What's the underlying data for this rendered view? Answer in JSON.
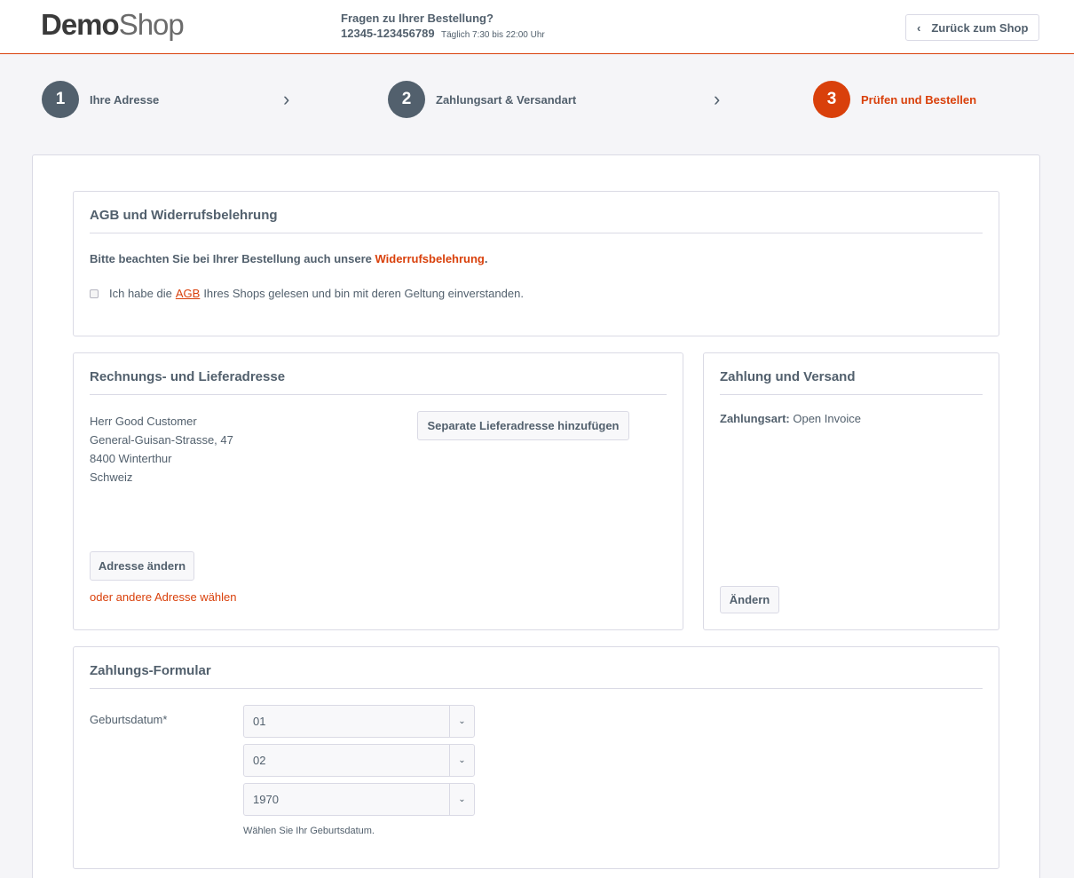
{
  "header": {
    "logo_demo": "Demo",
    "logo_shop": "Shop",
    "question": "Fragen zu Ihrer Bestellung?",
    "phone": "12345-123456789",
    "hours": "Täglich 7:30 bis 22:00 Uhr",
    "back_label": "Zurück zum Shop"
  },
  "steps": [
    {
      "number": "1",
      "label": "Ihre Adresse"
    },
    {
      "number": "2",
      "label": "Zahlungsart & Versandart"
    },
    {
      "number": "3",
      "label": "Prüfen und Bestellen"
    }
  ],
  "agb": {
    "title": "AGB und Widerrufsbelehrung",
    "note_prefix": "Bitte beachten Sie bei Ihrer Bestellung auch unsere ",
    "note_link": "Widerrufsbelehrung",
    "note_suffix": ".",
    "check_prefix": "Ich habe die",
    "check_link": "AGB",
    "check_suffix": "Ihres Shops gelesen und bin mit deren Geltung einverstanden."
  },
  "address": {
    "title": "Rechnungs- und Lieferadresse",
    "lines": [
      "Herr Good Customer",
      "General-Guisan-Strasse, 47",
      "8400 Winterthur",
      "Schweiz"
    ],
    "separate_button": "Separate Lieferadresse hinzufügen",
    "change_button": "Adresse ändern",
    "other_link": "oder andere Adresse wählen"
  },
  "payment": {
    "title": "Zahlung und Versand",
    "label": "Zahlungsart:",
    "value": "Open Invoice",
    "change_button": "Ändern"
  },
  "form": {
    "title": "Zahlungs-Formular",
    "dob_label": "Geburtsdatum*",
    "day": "01",
    "month": "02",
    "year": "1970",
    "hint": "Wählen Sie Ihr Geburtsdatum."
  },
  "colors": {
    "accent": "#d9400b",
    "text": "#52606d",
    "step_inactive": "#52606d"
  }
}
